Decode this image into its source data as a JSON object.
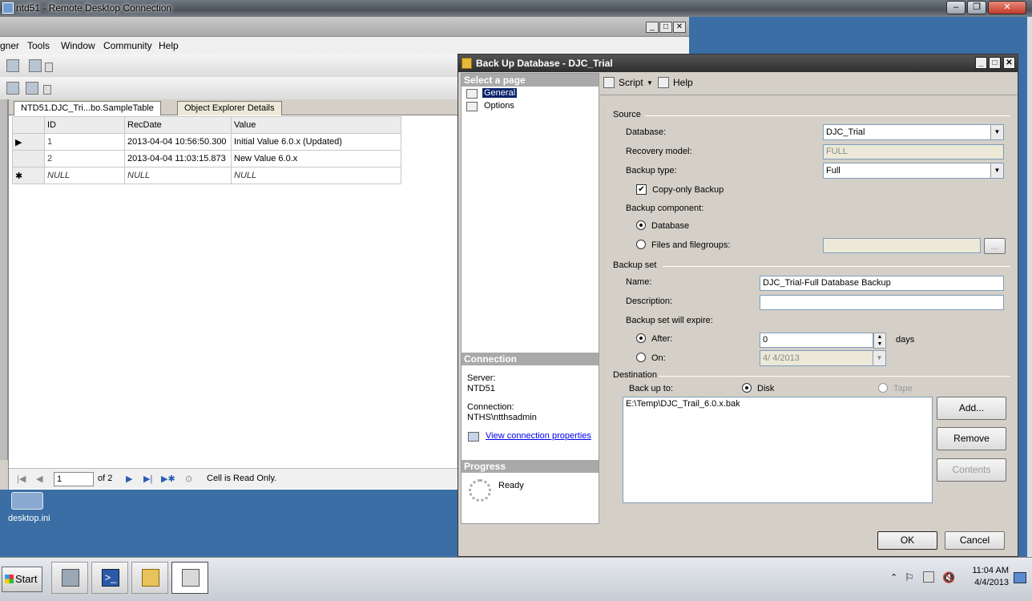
{
  "rdp": {
    "title": "ntd51 - Remote Desktop Connection",
    "minimize": "–",
    "restore": "❐",
    "close": "✕"
  },
  "ssms": {
    "menu": [
      "gner",
      "Tools",
      "Window",
      "Community",
      "Help"
    ],
    "tabs": [
      "NTD51.DJC_Tri...bo.SampleTable",
      "Object Explorer Details"
    ],
    "columns": [
      "ID",
      "RecDate",
      "Value"
    ],
    "rows": [
      {
        "marker": "▶",
        "id": "1",
        "date": "2013-04-04 10:56:50.300",
        "value": "Initial Value 6.0.x (Updated)"
      },
      {
        "marker": "",
        "id": "2",
        "date": "2013-04-04 11:03:15.873",
        "value": "New Value 6.0.x"
      },
      {
        "marker": "✱",
        "id": "NULL",
        "date": "NULL",
        "value": "NULL"
      }
    ],
    "nav": {
      "page": "1",
      "of": "of 2",
      "status": "Cell is Read Only."
    }
  },
  "desktop": {
    "icon_label": "desktop.ini"
  },
  "dialog": {
    "title": "Back Up Database - DJC_Trial",
    "select_page": "Select a page",
    "pages": [
      "General",
      "Options"
    ],
    "connection": {
      "heading": "Connection",
      "server_label": "Server:",
      "server": "NTD51",
      "conn_label": "Connection:",
      "conn": "NTHS\\ntthsadmin",
      "link": "View connection properties"
    },
    "progress": {
      "heading": "Progress",
      "status": "Ready"
    },
    "toolbar": {
      "script": "Script",
      "help": "Help"
    },
    "source": {
      "group": "Source",
      "database_label": "Database:",
      "database": "DJC_Trial",
      "recovery_label": "Recovery model:",
      "recovery": "FULL",
      "type_label": "Backup type:",
      "type": "Full",
      "copy_only": "Copy-only Backup",
      "component_label": "Backup component:",
      "comp_database": "Database",
      "comp_files": "Files and filegroups:",
      "browse": "..."
    },
    "backup_set": {
      "group": "Backup set",
      "name_label": "Name:",
      "name": "DJC_Trial-Full Database Backup",
      "desc_label": "Description:",
      "desc": "",
      "expire_label": "Backup set will expire:",
      "after_label": "After:",
      "after": "0",
      "days": "days",
      "on_label": "On:",
      "on": "4/  4/2013"
    },
    "destination": {
      "group": "Destination",
      "backup_to": "Back up to:",
      "disk": "Disk",
      "tape": "Tape",
      "path": "E:\\Temp\\DJC_Trail_6.0.x.bak",
      "add": "Add...",
      "remove": "Remove",
      "contents": "Contents"
    },
    "ok": "OK",
    "cancel": "Cancel"
  },
  "taskbar": {
    "start": "Start",
    "time": "11:04 AM",
    "date": "4/4/2013"
  }
}
